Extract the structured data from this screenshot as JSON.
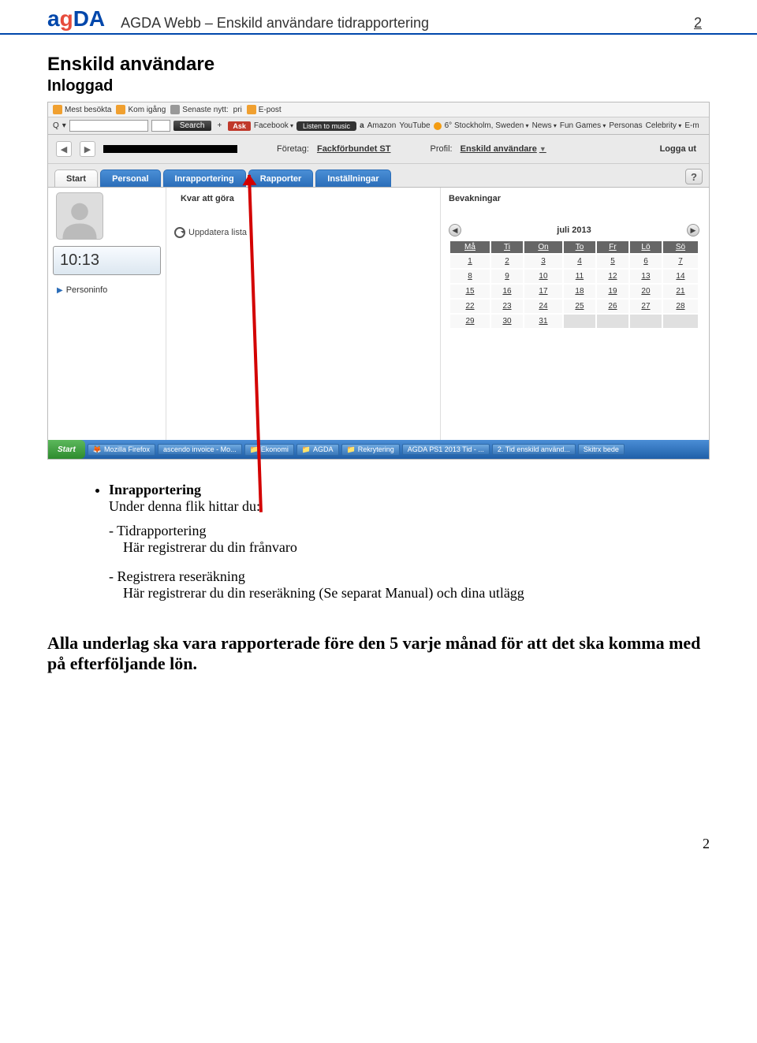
{
  "header": {
    "logo": "agDA",
    "title": "AGDA Webb – Enskild användare tidrapportering",
    "page_top": "2"
  },
  "doc": {
    "h2": "Enskild användare",
    "h3": "Inloggad"
  },
  "bookmarks": {
    "items": [
      "Mest besökta",
      "Kom igång",
      "Senaste nytt:",
      "pri",
      "E-post"
    ]
  },
  "toolbar": {
    "search_label": "Q",
    "search_btn": "Search",
    "plus": "+",
    "ask": "Ask",
    "items": [
      "Facebook",
      "Listen to music",
      "Amazon",
      "YouTube",
      "6° Stockholm, Sweden",
      "News",
      "Fun Games",
      "Personas",
      "Celebrity",
      "E-m"
    ]
  },
  "infobar": {
    "company_label": "Företag:",
    "company_value": "Fackförbundet ST",
    "profile_label": "Profil:",
    "profile_value": "Enskild användare",
    "logout": "Logga ut"
  },
  "tabs": [
    "Start",
    "Personal",
    "Inrapportering",
    "Rapporter",
    "Inställningar"
  ],
  "help": "?",
  "left": {
    "clock": "10:13",
    "personinfo": "Personinfo"
  },
  "mid": {
    "title": "Kvar att göra",
    "refresh": "Uppdatera lista"
  },
  "right": {
    "title": "Bevakningar",
    "cal_title": "juli 2013",
    "days": [
      "Må",
      "Ti",
      "On",
      "To",
      "Fr",
      "Lö",
      "Sö"
    ],
    "rows": [
      [
        "1",
        "2",
        "3",
        "4",
        "5",
        "6",
        "7"
      ],
      [
        "8",
        "9",
        "10",
        "11",
        "12",
        "13",
        "14"
      ],
      [
        "15",
        "16",
        "17",
        "18",
        "19",
        "20",
        "21"
      ],
      [
        "22",
        "23",
        "24",
        "25",
        "26",
        "27",
        "28"
      ],
      [
        "29",
        "30",
        "31",
        "",
        "",
        "",
        ""
      ]
    ]
  },
  "taskbar": {
    "start": "Start",
    "items": [
      "Mozilla Firefox",
      "ascendo invoice - Mo...",
      "Ekonomi",
      "AGDA",
      "Rekrytering",
      "AGDA PS1 2013 Tid - ...",
      "2. Tid enskild använd...",
      "Skitrx bede"
    ]
  },
  "bullets": {
    "main": "Inrapportering",
    "main_sub": "Under denna flik hittar du:",
    "item1_title": "- Tidrapportering",
    "item1_body": "Här registrerar du din frånvaro",
    "item2_title": "- Registrera reseräkning",
    "item2_body": "Här registrerar du din reseräkning (Se separat Manual) och dina utlägg"
  },
  "note": "Alla underlag ska vara rapporterade före den 5 varje månad för att det ska komma med på efterföljande lön.",
  "footer_page": "2"
}
